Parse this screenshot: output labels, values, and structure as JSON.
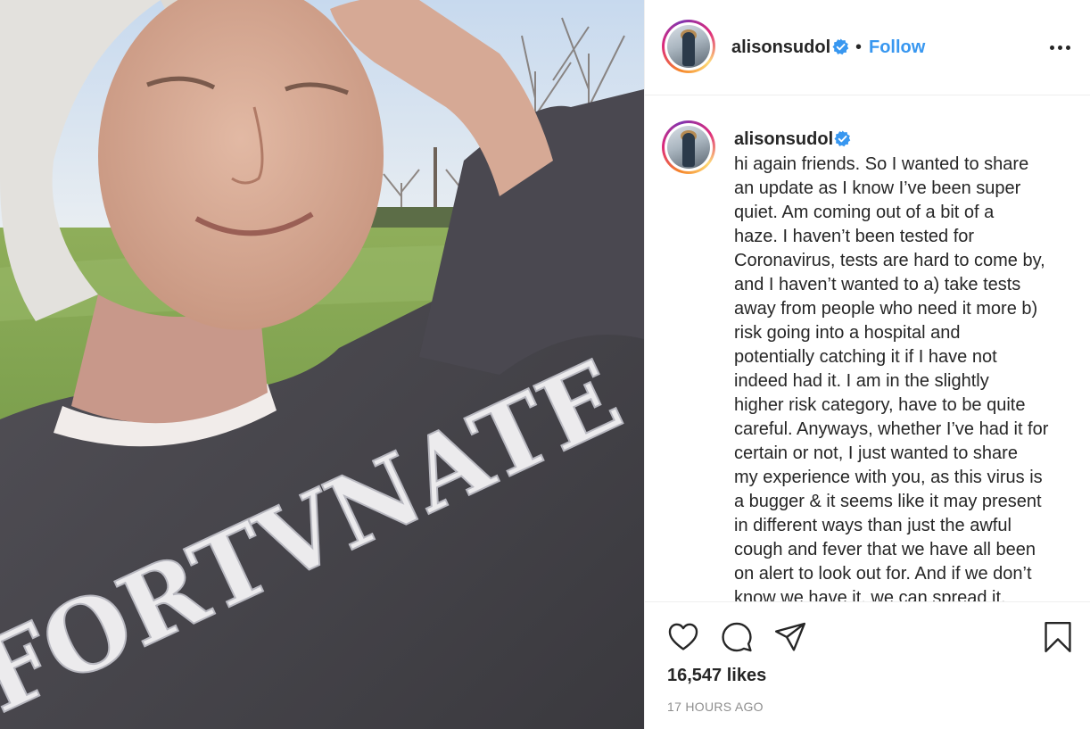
{
  "photo": {
    "alt": "",
    "sweater_text": "FORTVNATE"
  },
  "header": {
    "username": "alisonsudol",
    "separator": "•",
    "follow_label": "Follow"
  },
  "caption": {
    "username": "alisonsudol",
    "text": "hi again friends. So I wanted to share\nan update as I know I’ve been super\nquiet. Am coming out of a bit of a\nhaze. I haven’t been tested for\nCoronavirus, tests are hard to come by,\nand I haven’t wanted to a) take tests\naway from people who need it more b)\nrisk going into a hospital and\npotentially catching it if I have not\nindeed had it. I am in the slightly\nhigher risk category, have to be quite\ncareful. Anyways, whether I’ve had it for\ncertain or not, I just wanted to share\nmy experience with you, as this virus is\na bugger & it seems like it may present\nin different ways than just the awful\ncough and fever that we have all been\non alert to look out for. And if we don’t\nknow we have it, we can spread it."
  },
  "stats": {
    "likes": "16,547 likes",
    "time": "17 HOURS AGO"
  },
  "icons": {
    "verified": "verified-badge-icon",
    "more": "more-options-icon",
    "like": "heart-icon",
    "comment": "comment-icon",
    "share": "share-icon",
    "save": "bookmark-icon"
  },
  "colors": {
    "accent": "#3897f0",
    "text": "#262626",
    "muted": "#8e8e8e",
    "divider": "#efefef"
  }
}
